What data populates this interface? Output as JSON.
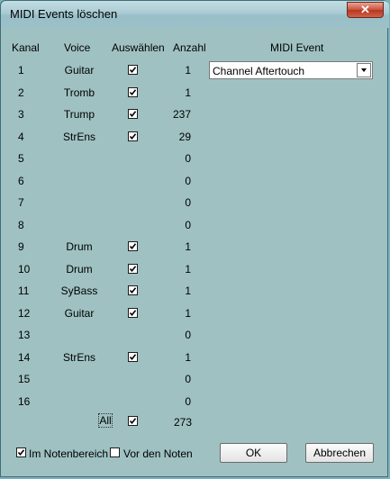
{
  "window": {
    "title": "MIDI Events löschen",
    "close_glyph": "✕"
  },
  "headers": {
    "kanal": "Kanal",
    "voice": "Voice",
    "auswaehlen": "Auswählen",
    "anzahl": "Anzahl",
    "midi_event": "MIDI Event"
  },
  "rows": [
    {
      "kanal": "1",
      "voice": "Guitar",
      "checked": true,
      "anzahl": "1"
    },
    {
      "kanal": "2",
      "voice": "Tromb",
      "checked": true,
      "anzahl": "1"
    },
    {
      "kanal": "3",
      "voice": "Trump",
      "checked": true,
      "anzahl": "237"
    },
    {
      "kanal": "4",
      "voice": "StrEns",
      "checked": true,
      "anzahl": "29"
    },
    {
      "kanal": "5",
      "voice": "",
      "checked": false,
      "anzahl": "0"
    },
    {
      "kanal": "6",
      "voice": "",
      "checked": false,
      "anzahl": "0"
    },
    {
      "kanal": "7",
      "voice": "",
      "checked": false,
      "anzahl": "0"
    },
    {
      "kanal": "8",
      "voice": "",
      "checked": false,
      "anzahl": "0"
    },
    {
      "kanal": "9",
      "voice": "Drum",
      "checked": true,
      "anzahl": "1"
    },
    {
      "kanal": "10",
      "voice": "Drum",
      "checked": true,
      "anzahl": "1"
    },
    {
      "kanal": "11",
      "voice": "SyBass",
      "checked": true,
      "anzahl": "1"
    },
    {
      "kanal": "12",
      "voice": "Guitar",
      "checked": true,
      "anzahl": "1"
    },
    {
      "kanal": "13",
      "voice": "",
      "checked": false,
      "anzahl": "0"
    },
    {
      "kanal": "14",
      "voice": "StrEns",
      "checked": true,
      "anzahl": "1"
    },
    {
      "kanal": "15",
      "voice": "",
      "checked": false,
      "anzahl": "0"
    },
    {
      "kanal": "16",
      "voice": "",
      "checked": false,
      "anzahl": "0"
    }
  ],
  "all_row": {
    "label": "All",
    "checked": true,
    "total": "273"
  },
  "midi_event": {
    "selected": "Channel Aftertouch"
  },
  "options": {
    "im_notenbereich": {
      "label": "Im Notenbereich",
      "checked": true
    },
    "vor_den_noten": {
      "label": "Vor den Noten",
      "checked": false
    }
  },
  "buttons": {
    "ok": "OK",
    "cancel": "Abbrechen"
  },
  "colors": {
    "dialog_bg": "#a0c2c4",
    "titlebar": "#a9cbd3",
    "close": "#c9503a"
  }
}
